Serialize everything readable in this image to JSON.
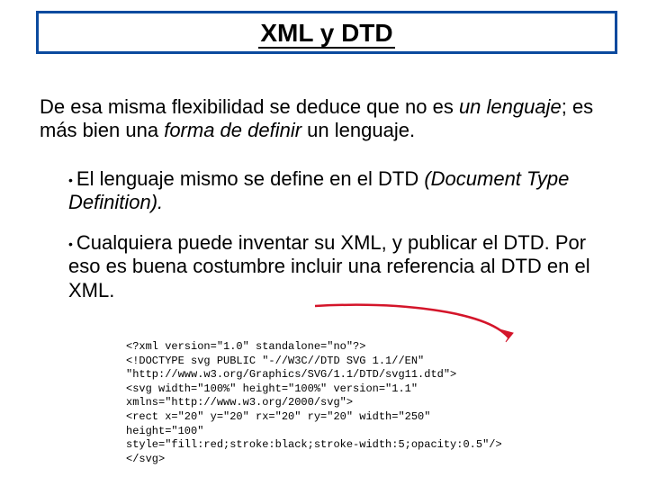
{
  "title": "XML y DTD",
  "paragraph1_plain_before": "De esa misma flexibilidad se deduce que no es ",
  "paragraph1_em1": "un lenguaje",
  "paragraph1_mid": "; es más bien una ",
  "paragraph1_em2": "forma de definir",
  "paragraph1_after": " un lenguaje.",
  "bullet1_before": "El lenguaje mismo se define en el DTD ",
  "bullet1_em": "(Document Type Definition).",
  "bullet2": "Cualquiera puede inventar su XML, y publicar el DTD. Por eso es buena costumbre incluir una referencia al DTD en el XML.",
  "code": "<?xml version=\"1.0\" standalone=\"no\"?>\n<!DOCTYPE svg PUBLIC \"-//W3C//DTD SVG 1.1//EN\"\n\"http://www.w3.org/Graphics/SVG/1.1/DTD/svg11.dtd\">\n<svg width=\"100%\" height=\"100%\" version=\"1.1\"\nxmlns=\"http://www.w3.org/2000/svg\">\n<rect x=\"20\" y=\"20\" rx=\"20\" ry=\"20\" width=\"250\"\nheight=\"100\"\nstyle=\"fill:red;stroke:black;stroke-width:5;opacity:0.5\"/>\n</svg>"
}
